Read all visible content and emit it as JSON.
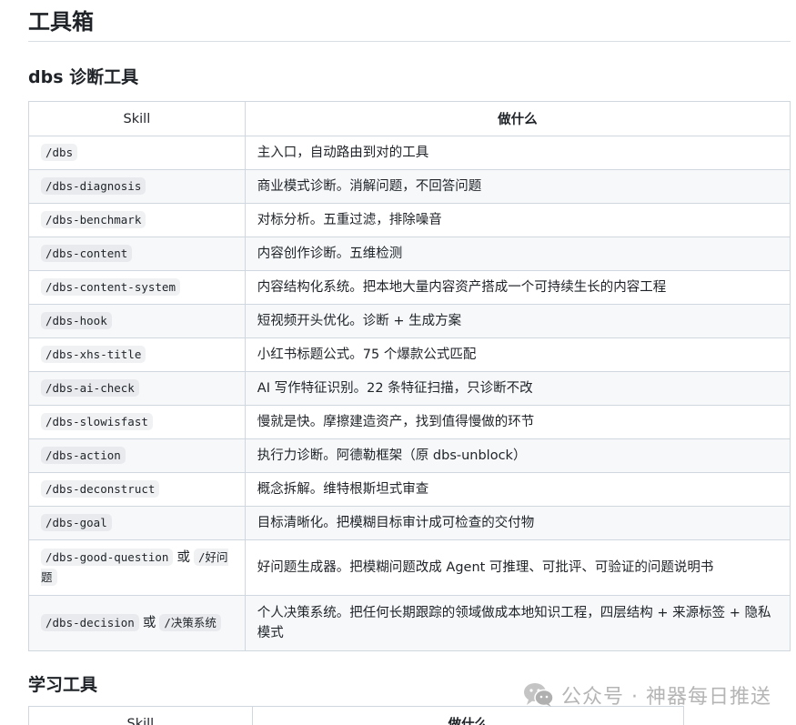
{
  "page": {
    "title": "工具箱",
    "sections": [
      {
        "heading": "dbs 诊断工具",
        "headers": {
          "skill": "Skill",
          "desc": "做什么"
        },
        "rows": [
          {
            "skill": "/dbs",
            "desc": "主入口，自动路由到对的工具"
          },
          {
            "skill": "/dbs-diagnosis",
            "desc": "商业模式诊断。消解问题，不回答问题"
          },
          {
            "skill": "/dbs-benchmark",
            "desc": "对标分析。五重过滤，排除噪音"
          },
          {
            "skill": "/dbs-content",
            "desc": "内容创作诊断。五维检测"
          },
          {
            "skill": "/dbs-content-system",
            "desc": "内容结构化系统。把本地大量内容资产搭成一个可持续生长的内容工程"
          },
          {
            "skill": "/dbs-hook",
            "desc": "短视频开头优化。诊断 + 生成方案"
          },
          {
            "skill": "/dbs-xhs-title",
            "desc": "小红书标题公式。75 个爆款公式匹配"
          },
          {
            "skill": "/dbs-ai-check",
            "desc": "AI 写作特征识别。22 条特征扫描，只诊断不改"
          },
          {
            "skill": "/dbs-slowisfast",
            "desc": "慢就是快。摩擦建造资产，找到值得慢做的环节"
          },
          {
            "skill": "/dbs-action",
            "desc": "执行力诊断。阿德勒框架（原 dbs-unblock）"
          },
          {
            "skill": "/dbs-deconstruct",
            "desc": "概念拆解。维特根斯坦式审查"
          },
          {
            "skill": "/dbs-goal",
            "desc": "目标清晰化。把模糊目标审计成可检查的交付物"
          },
          {
            "skill": "/dbs-good-question",
            "or_text": "或",
            "skill_alt": "/好问题",
            "desc": "好问题生成器。把模糊问题改成 Agent 可推理、可批评、可验证的问题说明书"
          },
          {
            "skill": "/dbs-decision",
            "or_text": "或",
            "skill_alt": "/决策系统",
            "desc": "个人决策系统。把任何长期跟踪的领域做成本地知识工程，四层结构 + 来源标签 + 隐私模式"
          }
        ]
      },
      {
        "heading": "学习工具",
        "headers": {
          "skill": "Skill",
          "desc": "做什么"
        }
      }
    ]
  },
  "watermark": {
    "text": "公众号 · 神器每日推送",
    "icon": "wechat-icon"
  }
}
